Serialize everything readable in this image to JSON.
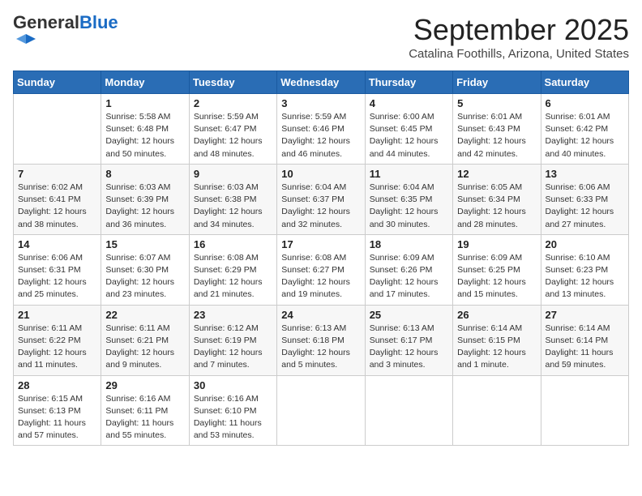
{
  "logo": {
    "general": "General",
    "blue": "Blue"
  },
  "header": {
    "month": "September 2025",
    "location": "Catalina Foothills, Arizona, United States"
  },
  "weekdays": [
    "Sunday",
    "Monday",
    "Tuesday",
    "Wednesday",
    "Thursday",
    "Friday",
    "Saturday"
  ],
  "weeks": [
    [
      {
        "day": "",
        "info": ""
      },
      {
        "day": "1",
        "info": "Sunrise: 5:58 AM\nSunset: 6:48 PM\nDaylight: 12 hours\nand 50 minutes."
      },
      {
        "day": "2",
        "info": "Sunrise: 5:59 AM\nSunset: 6:47 PM\nDaylight: 12 hours\nand 48 minutes."
      },
      {
        "day": "3",
        "info": "Sunrise: 5:59 AM\nSunset: 6:46 PM\nDaylight: 12 hours\nand 46 minutes."
      },
      {
        "day": "4",
        "info": "Sunrise: 6:00 AM\nSunset: 6:45 PM\nDaylight: 12 hours\nand 44 minutes."
      },
      {
        "day": "5",
        "info": "Sunrise: 6:01 AM\nSunset: 6:43 PM\nDaylight: 12 hours\nand 42 minutes."
      },
      {
        "day": "6",
        "info": "Sunrise: 6:01 AM\nSunset: 6:42 PM\nDaylight: 12 hours\nand 40 minutes."
      }
    ],
    [
      {
        "day": "7",
        "info": "Sunrise: 6:02 AM\nSunset: 6:41 PM\nDaylight: 12 hours\nand 38 minutes."
      },
      {
        "day": "8",
        "info": "Sunrise: 6:03 AM\nSunset: 6:39 PM\nDaylight: 12 hours\nand 36 minutes."
      },
      {
        "day": "9",
        "info": "Sunrise: 6:03 AM\nSunset: 6:38 PM\nDaylight: 12 hours\nand 34 minutes."
      },
      {
        "day": "10",
        "info": "Sunrise: 6:04 AM\nSunset: 6:37 PM\nDaylight: 12 hours\nand 32 minutes."
      },
      {
        "day": "11",
        "info": "Sunrise: 6:04 AM\nSunset: 6:35 PM\nDaylight: 12 hours\nand 30 minutes."
      },
      {
        "day": "12",
        "info": "Sunrise: 6:05 AM\nSunset: 6:34 PM\nDaylight: 12 hours\nand 28 minutes."
      },
      {
        "day": "13",
        "info": "Sunrise: 6:06 AM\nSunset: 6:33 PM\nDaylight: 12 hours\nand 27 minutes."
      }
    ],
    [
      {
        "day": "14",
        "info": "Sunrise: 6:06 AM\nSunset: 6:31 PM\nDaylight: 12 hours\nand 25 minutes."
      },
      {
        "day": "15",
        "info": "Sunrise: 6:07 AM\nSunset: 6:30 PM\nDaylight: 12 hours\nand 23 minutes."
      },
      {
        "day": "16",
        "info": "Sunrise: 6:08 AM\nSunset: 6:29 PM\nDaylight: 12 hours\nand 21 minutes."
      },
      {
        "day": "17",
        "info": "Sunrise: 6:08 AM\nSunset: 6:27 PM\nDaylight: 12 hours\nand 19 minutes."
      },
      {
        "day": "18",
        "info": "Sunrise: 6:09 AM\nSunset: 6:26 PM\nDaylight: 12 hours\nand 17 minutes."
      },
      {
        "day": "19",
        "info": "Sunrise: 6:09 AM\nSunset: 6:25 PM\nDaylight: 12 hours\nand 15 minutes."
      },
      {
        "day": "20",
        "info": "Sunrise: 6:10 AM\nSunset: 6:23 PM\nDaylight: 12 hours\nand 13 minutes."
      }
    ],
    [
      {
        "day": "21",
        "info": "Sunrise: 6:11 AM\nSunset: 6:22 PM\nDaylight: 12 hours\nand 11 minutes."
      },
      {
        "day": "22",
        "info": "Sunrise: 6:11 AM\nSunset: 6:21 PM\nDaylight: 12 hours\nand 9 minutes."
      },
      {
        "day": "23",
        "info": "Sunrise: 6:12 AM\nSunset: 6:19 PM\nDaylight: 12 hours\nand 7 minutes."
      },
      {
        "day": "24",
        "info": "Sunrise: 6:13 AM\nSunset: 6:18 PM\nDaylight: 12 hours\nand 5 minutes."
      },
      {
        "day": "25",
        "info": "Sunrise: 6:13 AM\nSunset: 6:17 PM\nDaylight: 12 hours\nand 3 minutes."
      },
      {
        "day": "26",
        "info": "Sunrise: 6:14 AM\nSunset: 6:15 PM\nDaylight: 12 hours\nand 1 minute."
      },
      {
        "day": "27",
        "info": "Sunrise: 6:14 AM\nSunset: 6:14 PM\nDaylight: 11 hours\nand 59 minutes."
      }
    ],
    [
      {
        "day": "28",
        "info": "Sunrise: 6:15 AM\nSunset: 6:13 PM\nDaylight: 11 hours\nand 57 minutes."
      },
      {
        "day": "29",
        "info": "Sunrise: 6:16 AM\nSunset: 6:11 PM\nDaylight: 11 hours\nand 55 minutes."
      },
      {
        "day": "30",
        "info": "Sunrise: 6:16 AM\nSunset: 6:10 PM\nDaylight: 11 hours\nand 53 minutes."
      },
      {
        "day": "",
        "info": ""
      },
      {
        "day": "",
        "info": ""
      },
      {
        "day": "",
        "info": ""
      },
      {
        "day": "",
        "info": ""
      }
    ]
  ]
}
